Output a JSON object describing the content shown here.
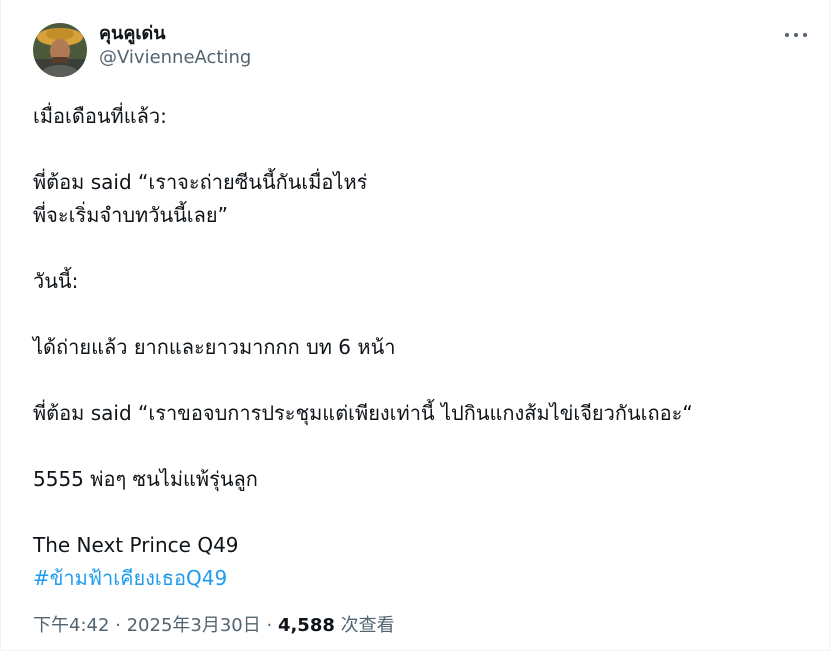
{
  "author": {
    "display_name": "คุนคูเด่น",
    "handle": "@VivienneActing"
  },
  "tweet": {
    "lines": [
      "เมื่อเดือนที่แล้ว:",
      "",
      "พี่ต้อม said “เราจะถ่ายซีนนี้กันเมื่อไหร่",
      "พี่จะเริ่มจำบทวันนี้เลย”",
      "",
      "วันนี้:",
      "",
      "ได้ถ่ายแล้ว ยากและยาวมากกก บท 6 หน้า",
      "",
      "พี่ต้อม said “เราขอจบการประชุมแต่เพียงเท่านี้ ไปกินแกงส้มไข่เจียวกันเถอะ“",
      "",
      "5555 พ่อๆ ซนไม่แพ้รุ่นลูก",
      "",
      "The Next Prince Q49"
    ],
    "hashtag": "#ข้ามฟ้าเคียงเธอQ49"
  },
  "meta": {
    "time": "下午4:42",
    "separator1": " · ",
    "date": "2025年3月30日",
    "separator2": " · ",
    "views_count": "4,588",
    "views_label": " 次查看"
  },
  "colors": {
    "text": "#0f1419",
    "secondary": "#536471",
    "link": "#1d9bf0",
    "border": "#eff3f4"
  },
  "icons": {
    "more": "more-horizontal-icon"
  }
}
